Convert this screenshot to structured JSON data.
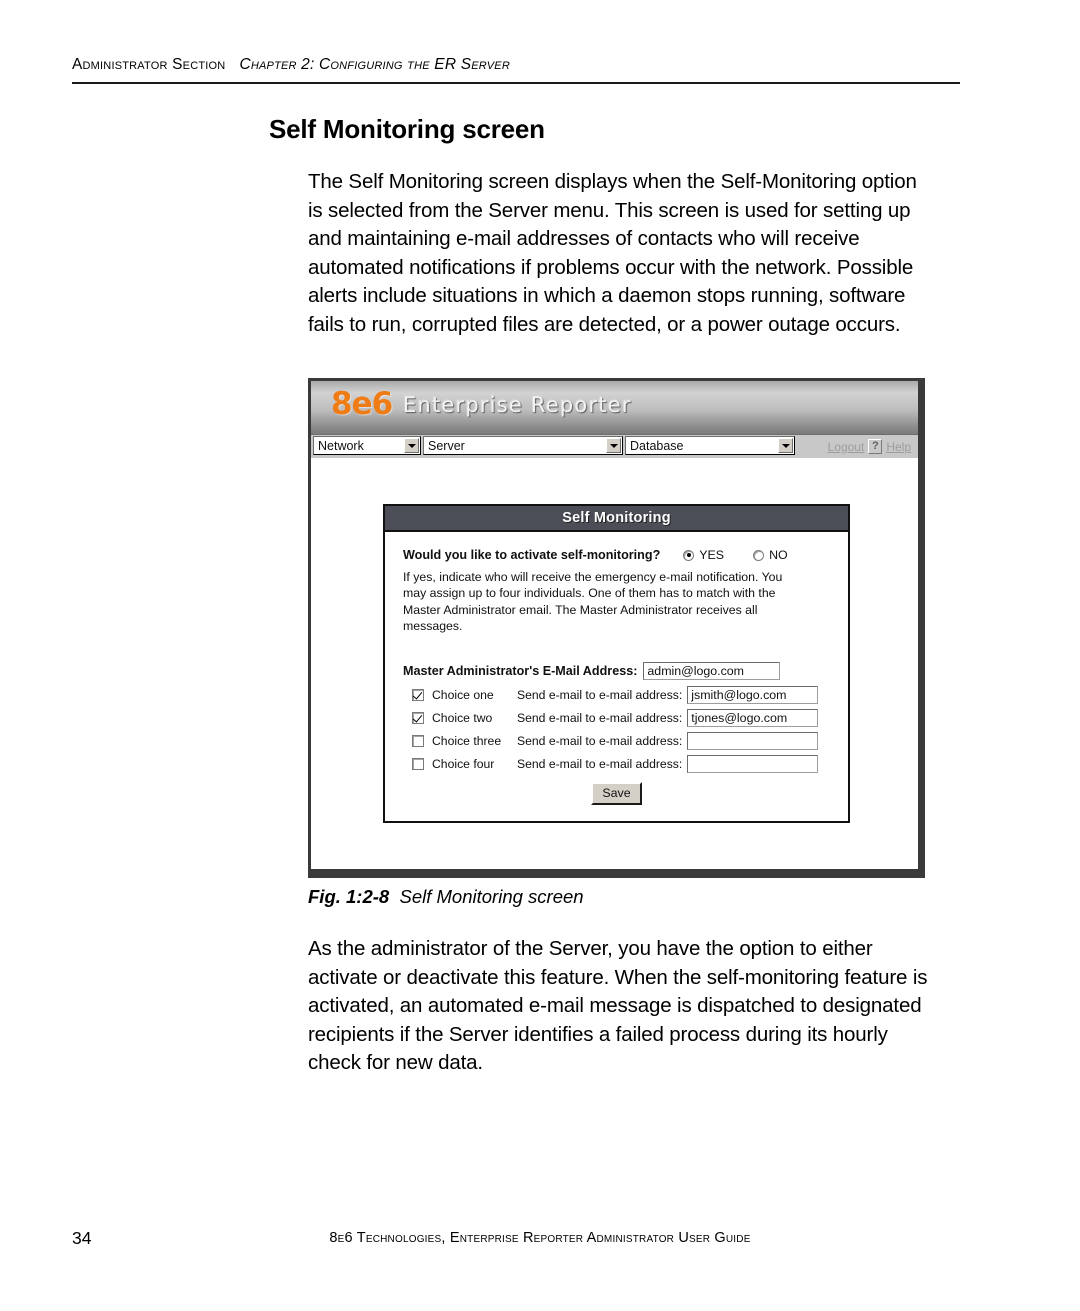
{
  "page": {
    "header": {
      "section": "Administrator Section",
      "chapter": "Chapter 2: Configuring the ER Server"
    },
    "section_title": "Self Monitoring screen",
    "paragraphs": {
      "intro": "The Self Monitoring screen displays when the Self-Monitoring option is selected from the Server menu. This screen is used for setting up and maintaining e-mail addresses of contacts who will receive automated notifications if problems occur with the network. Possible alerts include situations in which a daemon stops running, software fails to run, corrupted files are detected, or a power outage occurs.",
      "after_figure": "As the administrator of the Server, you have the option to either activate or deactivate this feature. When the self-monitoring feature is activated, an automated e-mail message is dispatched to designated recipients if the Server identifies a failed process during its hourly check for new data."
    },
    "figure": {
      "caption_number": "Fig. 1:2-8",
      "caption_text": "Self Monitoring screen"
    },
    "footer": {
      "page_number": "34",
      "guide_title": "8e6 Technologies, Enterprise Reporter Administrator User Guide"
    }
  },
  "app": {
    "brand_logo": "8e6",
    "brand_name": "Enterprise Reporter",
    "brand_color": "#f07c16",
    "menubar": {
      "dropdowns": [
        {
          "name": "network",
          "selected": "Network"
        },
        {
          "name": "server",
          "selected": "Server"
        },
        {
          "name": "database",
          "selected": "Database"
        }
      ],
      "logout_label": "Logout",
      "help_icon_label": "?",
      "help_label": "Help"
    },
    "panel": {
      "title": "Self Monitoring",
      "question_label": "Would you like to activate self-monitoring?",
      "radio_options": [
        {
          "label": "YES",
          "selected": true
        },
        {
          "label": "NO",
          "selected": false
        }
      ],
      "help_text": "If yes, indicate who will receive the emergency e-mail notification. You may assign up to four individuals. One of them has to match with the Master Administrator email. The Master Administrator receives all messages.",
      "master_label": "Master Administrator's E-Mail Address:",
      "master_email": "admin@logo.com",
      "choices": [
        {
          "label": "Choice one",
          "checked": true,
          "send_label": "Send e-mail to e-mail address:",
          "email": "jsmith@logo.com"
        },
        {
          "label": "Choice two",
          "checked": true,
          "send_label": "Send e-mail to e-mail address:",
          "email": "tjones@logo.com"
        },
        {
          "label": "Choice three",
          "checked": false,
          "send_label": "Send e-mail to e-mail address:",
          "email": ""
        },
        {
          "label": "Choice four",
          "checked": false,
          "send_label": "Send e-mail to e-mail address:",
          "email": ""
        }
      ],
      "save_label": "Save"
    }
  }
}
